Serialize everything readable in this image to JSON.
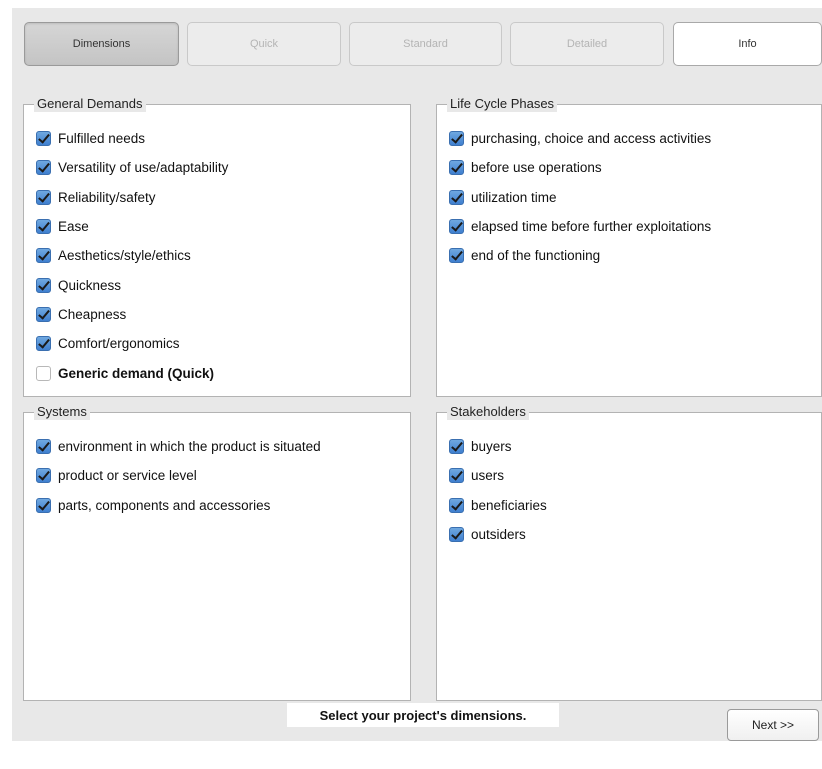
{
  "tabs": [
    {
      "label": "Dimensions",
      "state": "active"
    },
    {
      "label": "Quick",
      "state": "disabled"
    },
    {
      "label": "Standard",
      "state": "disabled"
    },
    {
      "label": "Detailed",
      "state": "disabled"
    },
    {
      "label": "Info",
      "state": "normal"
    }
  ],
  "panels": {
    "general_demands": {
      "title": "General Demands",
      "items": [
        {
          "label": "Fulfilled needs",
          "checked": true
        },
        {
          "label": "Versatility of use/adaptability",
          "checked": true
        },
        {
          "label": "Reliability/safety",
          "checked": true
        },
        {
          "label": "Ease",
          "checked": true
        },
        {
          "label": "Aesthetics/style/ethics",
          "checked": true
        },
        {
          "label": "Quickness",
          "checked": true
        },
        {
          "label": "Cheapness",
          "checked": true
        },
        {
          "label": "Comfort/ergonomics",
          "checked": true
        },
        {
          "label": "Generic demand (Quick)",
          "checked": false
        }
      ]
    },
    "life_cycle_phases": {
      "title": "Life Cycle Phases",
      "items": [
        {
          "label": "purchasing, choice and access activities",
          "checked": true
        },
        {
          "label": "before use operations",
          "checked": true
        },
        {
          "label": "utilization time",
          "checked": true
        },
        {
          "label": "elapsed time before further exploitations",
          "checked": true
        },
        {
          "label": "end of the functioning",
          "checked": true
        }
      ]
    },
    "systems": {
      "title": "Systems",
      "items": [
        {
          "label": "environment in which the product is situated",
          "checked": true
        },
        {
          "label": "product or service level",
          "checked": true
        },
        {
          "label": "parts, components and accessories",
          "checked": true
        }
      ]
    },
    "stakeholders": {
      "title": "Stakeholders",
      "items": [
        {
          "label": "buyers",
          "checked": true
        },
        {
          "label": "users",
          "checked": true
        },
        {
          "label": "beneficiaries",
          "checked": true
        },
        {
          "label": "outsiders",
          "checked": true
        }
      ]
    }
  },
  "footer": {
    "status": "Select your project's dimensions.",
    "next_label": "Next >>"
  },
  "colors": {
    "window_bg": "#e8e8e8",
    "checkbox_accent": "#4a8bd6"
  }
}
